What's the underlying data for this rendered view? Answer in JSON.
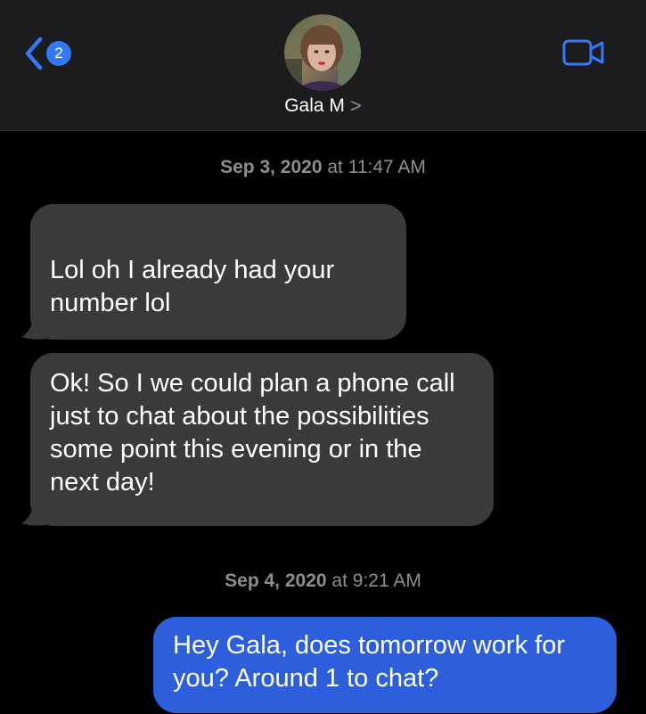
{
  "header": {
    "back_badge_count": "2",
    "contact_name": "Gala M",
    "chevron": ">"
  },
  "conversation": {
    "sections": [
      {
        "date": "Sep 3, 2020",
        "time": "at 11:47 AM",
        "messages": [
          {
            "direction": "incoming",
            "text": "Lol oh I already had your number lol"
          },
          {
            "direction": "incoming",
            "text": "Ok! So I we could plan a phone call just to chat about the possibilities some point this evening or in the next day!"
          }
        ]
      },
      {
        "date": "Sep 4, 2020",
        "time": "at 9:21 AM",
        "messages": [
          {
            "direction": "outgoing",
            "text": "Hey Gala, does tomorrow work for you? Around 1 to chat?"
          }
        ]
      }
    ]
  },
  "colors": {
    "background": "#000000",
    "header_bg": "#1c1c1e",
    "incoming_bubble": "#3a3a3c",
    "outgoing_bubble": "#2d5fdc",
    "accent": "#3478f6",
    "timestamp": "#8e8e93"
  },
  "icons": {
    "back": "chevron-left-icon",
    "video": "video-camera-icon",
    "disclosure": "chevron-right-icon"
  }
}
